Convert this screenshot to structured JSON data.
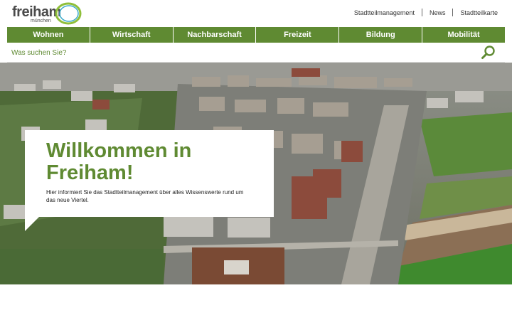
{
  "logo": {
    "wordmark": "freiham",
    "subline": "münchen"
  },
  "meta_nav": [
    {
      "label": "Stadtteilmanagement"
    },
    {
      "label": "News"
    },
    {
      "label": "Stadtteilkarte"
    }
  ],
  "main_nav": [
    {
      "label": "Wohnen"
    },
    {
      "label": "Wirtschaft"
    },
    {
      "label": "Nachbarschaft"
    },
    {
      "label": "Freizeit"
    },
    {
      "label": "Bildung"
    },
    {
      "label": "Mobilität"
    }
  ],
  "search": {
    "placeholder": "Was suchen Sie?",
    "icon": "search-icon"
  },
  "hero": {
    "title_line1": "Willkommen in",
    "title_line2": "Freiham!",
    "text": "Hier informiert Sie das Stadtteilmanagement über alles Wissenswerte rund um das neue Viertel."
  },
  "colors": {
    "brand_green": "#5f8a32",
    "logo_ring_outer": "#8fbf3a",
    "logo_ring_inner": "#3aa9c9"
  }
}
